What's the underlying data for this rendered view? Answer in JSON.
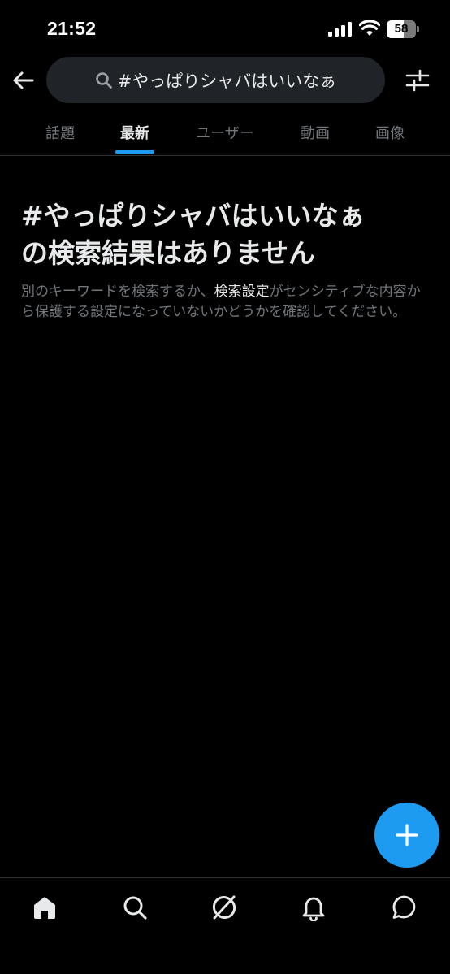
{
  "status_bar": {
    "time": "21:52",
    "battery_percent": 58,
    "battery_label": "58"
  },
  "header": {
    "back_icon": "arrow-left-icon",
    "search_query": "#やっぱりシャバはいいなぁ",
    "filter_icon": "sliders-icon"
  },
  "tabs": [
    {
      "label": "話題",
      "active": false
    },
    {
      "label": "最新",
      "active": true
    },
    {
      "label": "ユーザー",
      "active": false
    },
    {
      "label": "動画",
      "active": false
    },
    {
      "label": "画像",
      "active": false
    }
  ],
  "empty_state": {
    "title_line1": "#やっぱりシャバはいいなぁ",
    "title_line2": "の検索結果はありません",
    "body_before": "別のキーワードを検索するか、",
    "body_link": "検索設定",
    "body_after": "がセンシティブな内容から保護する設定になっていないかどうかを確認してください。"
  },
  "fab": {
    "icon": "plus-icon"
  },
  "bottom_nav": [
    {
      "icon": "home-icon"
    },
    {
      "icon": "search-icon"
    },
    {
      "icon": "grok-icon"
    },
    {
      "icon": "bell-icon"
    },
    {
      "icon": "message-icon"
    }
  ],
  "colors": {
    "background": "#000000",
    "accent": "#1d9bf0",
    "text_primary": "#e7e9ea",
    "text_secondary": "#71767b",
    "search_bg": "#202327",
    "divider": "#2f3336"
  }
}
